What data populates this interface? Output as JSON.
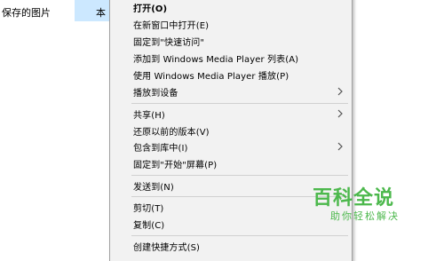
{
  "explorer": {
    "left_item": "保存的图片",
    "selected_item": "本"
  },
  "context_menu": {
    "items": [
      {
        "label": "打开(O)",
        "bold": true
      },
      {
        "label": "在新窗口中打开(E)"
      },
      {
        "label": "固定到\"快速访问\""
      },
      {
        "label": "添加到 Windows Media Player 列表(A)"
      },
      {
        "label": "使用 Windows Media Player 播放(P)"
      },
      {
        "label": "播放到设备",
        "submenu": true
      },
      {
        "label": "共享(H)",
        "submenu": true
      },
      {
        "label": "还原以前的版本(V)"
      },
      {
        "label": "包含到库中(I)",
        "submenu": true
      },
      {
        "label": "固定到\"开始\"屏幕(P)"
      },
      {
        "label": "发送到(N)",
        "submenu": true
      },
      {
        "label": "剪切(T)"
      },
      {
        "label": "复制(C)"
      },
      {
        "label": "创建快捷方式(S)"
      }
    ]
  },
  "watermark": {
    "title": "百科全说",
    "subtitle": "助你轻松解决"
  },
  "colors": {
    "menu_bg": "#f2f2f2",
    "selection": "#cce8ff",
    "watermark": "#4cb84c"
  },
  "icons": {
    "submenu": "chevron-right-icon"
  }
}
